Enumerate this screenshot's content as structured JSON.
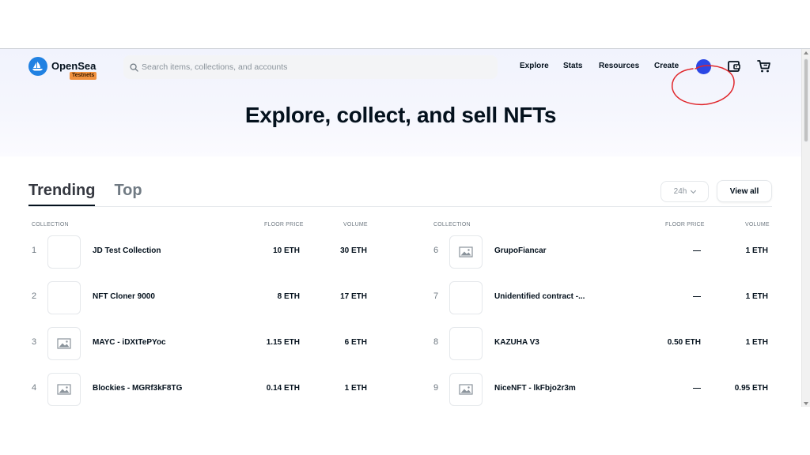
{
  "header": {
    "brand": "OpenSea",
    "badge": "Testnets",
    "search_placeholder": "Search items, collections, and accounts",
    "nav": [
      "Explore",
      "Stats",
      "Resources",
      "Create"
    ]
  },
  "hero": {
    "title": "Explore, collect, and sell NFTs"
  },
  "tabs": [
    "Trending",
    "Top"
  ],
  "controls": {
    "time_range": "24h",
    "view_all": "View all"
  },
  "columns": {
    "collection": "COLLECTION",
    "floor": "FLOOR PRICE",
    "volume": "VOLUME"
  },
  "collections_left": [
    {
      "rank": "1",
      "name": "JD Test Collection",
      "floor": "10 ETH",
      "volume": "30 ETH",
      "thumb": "blank"
    },
    {
      "rank": "2",
      "name": "NFT Cloner 9000",
      "floor": "8 ETH",
      "volume": "17 ETH",
      "thumb": "blank"
    },
    {
      "rank": "3",
      "name": "MAYC - iDXtTePYoc",
      "floor": "1.15 ETH",
      "volume": "6 ETH",
      "thumb": "image-icon"
    },
    {
      "rank": "4",
      "name": "Blockies - MGRf3kF8TG",
      "floor": "0.14 ETH",
      "volume": "1 ETH",
      "thumb": "image-icon"
    }
  ],
  "collections_right": [
    {
      "rank": "6",
      "name": "GrupoFiancar",
      "floor": "—",
      "volume": "1 ETH",
      "thumb": "image-icon"
    },
    {
      "rank": "7",
      "name": "Unidentified contract -...",
      "floor": "—",
      "volume": "1 ETH",
      "thumb": "blank"
    },
    {
      "rank": "8",
      "name": "KAZUHA V3",
      "floor": "0.50 ETH",
      "volume": "1 ETH",
      "thumb": "blank"
    },
    {
      "rank": "9",
      "name": "NiceNFT - lkFbjo2r3m",
      "floor": "—",
      "volume": "0.95 ETH",
      "thumb": "image-icon"
    }
  ],
  "colors": {
    "accent": "#2081e2",
    "avatar": "#2b47e4",
    "badge": "#f0913f",
    "annotation": "#e0262b"
  }
}
